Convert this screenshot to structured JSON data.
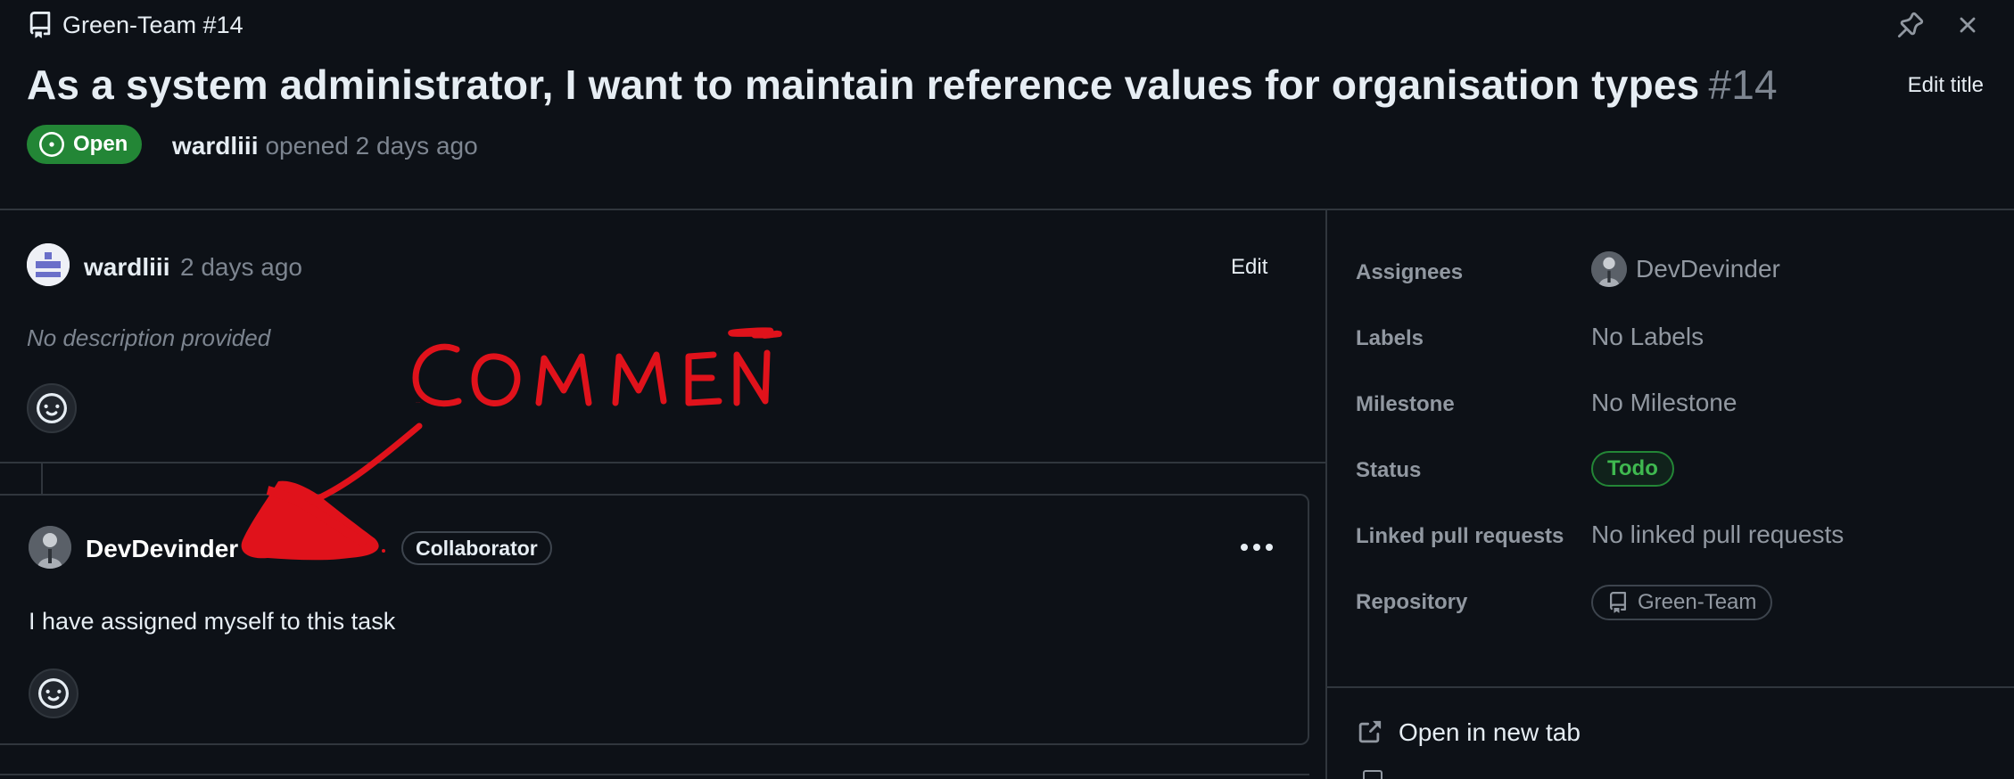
{
  "header": {
    "repo_ref": "Green-Team #14",
    "title": "As a system administrator, I want to maintain reference values for organisation types",
    "number": "#14",
    "edit_title_label": "Edit title",
    "state": "Open",
    "opened_by": "wardliii",
    "opened_text": "opened 2 days ago"
  },
  "comments": [
    {
      "author": "wardliii",
      "time": "2 days ago",
      "edit_label": "Edit",
      "body": "No description provided"
    },
    {
      "author": "DevDevinder",
      "role_badge": "Collaborator",
      "body": "I have assigned myself to this task"
    }
  ],
  "annotation": {
    "text": "COMMENT",
    "color": "#e0121b"
  },
  "sidebar": {
    "assignees_label": "Assignees",
    "assignee": "DevDevinder",
    "labels_label": "Labels",
    "labels_value": "No Labels",
    "milestone_label": "Milestone",
    "milestone_value": "No Milestone",
    "status_label": "Status",
    "status_value": "Todo",
    "linked_pr_label": "Linked pull requests",
    "linked_pr_value": "No linked pull requests",
    "repository_label": "Repository",
    "repository_value": "Green-Team",
    "open_in_new_tab": "Open in new tab"
  },
  "colors": {
    "background": "#0d1117",
    "border": "#30363d",
    "open_green": "#238636",
    "todo_green": "#3fb950",
    "muted": "#7d8590"
  },
  "icons": [
    "repo-icon",
    "pin-icon",
    "close-icon",
    "issue-open-icon",
    "smiley-icon",
    "kebab-horizontal-icon",
    "link-external-icon"
  ]
}
